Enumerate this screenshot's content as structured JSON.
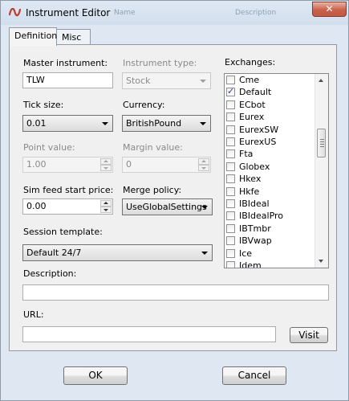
{
  "window": {
    "title": "Instrument Editor",
    "close_label": "✕",
    "ghost_left": "Name",
    "ghost_right": "Description"
  },
  "tabs": [
    {
      "label": "Definition"
    },
    {
      "label": "Misc"
    }
  ],
  "form": {
    "master_instrument": {
      "label": "Master instrument:",
      "value": "TLW"
    },
    "instrument_type": {
      "label": "Instrument type:",
      "value": "Stock"
    },
    "tick_size": {
      "label": "Tick size:",
      "value": "0.01"
    },
    "currency": {
      "label": "Currency:",
      "value": "BritishPound"
    },
    "point_value": {
      "label": "Point value:",
      "value": "1.00"
    },
    "margin_value": {
      "label": "Margin value:",
      "value": "0"
    },
    "sim_feed_start_price": {
      "label": "Sim feed start price:",
      "value": "0.00"
    },
    "merge_policy": {
      "label": "Merge policy:",
      "value": "UseGlobalSettings"
    },
    "session_template": {
      "label": "Session template:",
      "value": "Default 24/7"
    },
    "description": {
      "label": "Description:",
      "value": ""
    },
    "url": {
      "label": "URL:",
      "value": "",
      "visit_label": "Visit"
    }
  },
  "exchanges": {
    "label": "Exchanges:",
    "items": [
      {
        "name": "Cme",
        "checked": false
      },
      {
        "name": "Default",
        "checked": true
      },
      {
        "name": "ECbot",
        "checked": false
      },
      {
        "name": "Eurex",
        "checked": false
      },
      {
        "name": "EurexSW",
        "checked": false
      },
      {
        "name": "EurexUS",
        "checked": false
      },
      {
        "name": "Fta",
        "checked": false
      },
      {
        "name": "Globex",
        "checked": false
      },
      {
        "name": "Hkex",
        "checked": false
      },
      {
        "name": "Hkfe",
        "checked": false
      },
      {
        "name": "IBIdeal",
        "checked": false
      },
      {
        "name": "IBIdealPro",
        "checked": false
      },
      {
        "name": "IBTmbr",
        "checked": false
      },
      {
        "name": "IBVwap",
        "checked": false
      },
      {
        "name": "Ice",
        "checked": false
      },
      {
        "name": "Idem",
        "checked": false
      }
    ]
  },
  "buttons": {
    "ok": "OK",
    "cancel": "Cancel"
  },
  "icons": {
    "app": "ninja-logo-icon",
    "close": "close-icon"
  }
}
